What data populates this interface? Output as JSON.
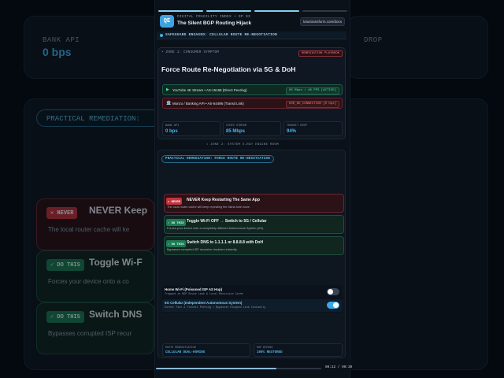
{
  "background": {
    "metric_left_label": "BANK API",
    "metric_left_value": "0 bps",
    "metric_right_label": "DROP",
    "pill_text": "PRACTICAL REMEDIATION:",
    "rows": [
      {
        "tag": "✕ NEVER",
        "title": "NEVER Keep",
        "sub": "The local router cache will ke"
      },
      {
        "tag": "✓ DO THIS",
        "title": "Toggle Wi-F",
        "sub": "Forces your device onto a co"
      },
      {
        "tag": "✓ DO THIS",
        "title": "Switch DNS",
        "sub": "Bypasses corrupted ISP recur"
      }
    ]
  },
  "header": {
    "logo": "QE",
    "kicker": "DIGITAL FRAGILITY INDEX • EP 03",
    "title": "The Silent BGP Routing Hijack",
    "url": "lotustransform.com/docs"
  },
  "progress": {
    "segments": 4,
    "done": 3
  },
  "safeguard": "SAFEGUARD ENGAGED: CELLULAR ROUTE RE-NEGOTIATION",
  "zone1": {
    "label": "• ZONE 1: CONSUMER SYMPTOM",
    "badge": "REMEDIATION PLAYBOOK",
    "title": "Force Route Re-Negotiation via 5G & DoH",
    "routes": [
      {
        "icon": "▶",
        "label": "YouTube 4K Stream • AS-15169 (Direct Peering)",
        "status": "85 Mbps • 48 PPS [ACTIVE]"
      },
      {
        "icon": "🏦",
        "label": "Monzo / Banking API • AS-64496 (Transit Link)",
        "status": "ERR_NO_CONNECTION [0 bps]"
      }
    ],
    "metrics": [
      {
        "label": "BANK API",
        "value": "0 bps"
      },
      {
        "label": "VIDEO STREAM",
        "value": "85 Mbps"
      },
      {
        "label": "TRANSIT DROP",
        "value": "94%"
      }
    ]
  },
  "zone2": {
    "label": "• ZONE 2: SYSTEM X-RAY ENGINE ROOM",
    "pill": "PRACTICAL REMEDIATION: FORCE ROUTE RE-NEGOTIATION",
    "actions": [
      {
        "tag": "✕ NEVER",
        "title": "NEVER Keep Restarting The Same App",
        "sub": "The local router cache will keep repeating the blank-hole route."
      },
      {
        "tag": "✓ DO THIS",
        "title": "Toggle Wi-Fi OFF → Switch to 5G / Cellular",
        "sub": "Forces your device onto a completely different Autonomous System (AS)."
      },
      {
        "tag": "✓ DO THIS",
        "title": "Switch DNS to 1.1.1.1 or 8.8.8.8 with DoH",
        "sub": "Bypasses corrupted ISP recursive resolvers instantly."
      }
    ],
    "toggles": [
      {
        "title": "Home Wi-Fi (Poisoned ISP AS Hop)",
        "sub": "Trapped in BGP Route Leak & Local Recursive Cache",
        "state": "off"
      },
      {
        "title": "5G Cellular (Independent Autonomous System)",
        "sub": "Direct Tier-1 Transit Peering • Bypasses Escaped Link Instantly",
        "state": "on"
      }
    ],
    "footer": [
      {
        "label": "ROUTE RENEGOTIATION",
        "value": "CELLULAR DUAL-HOMING"
      },
      {
        "label": "ROP BYPASS",
        "value": "100% RESTORED"
      }
    ]
  },
  "playback": {
    "time": "00:22 / 00:30",
    "fraction": 0.73
  }
}
